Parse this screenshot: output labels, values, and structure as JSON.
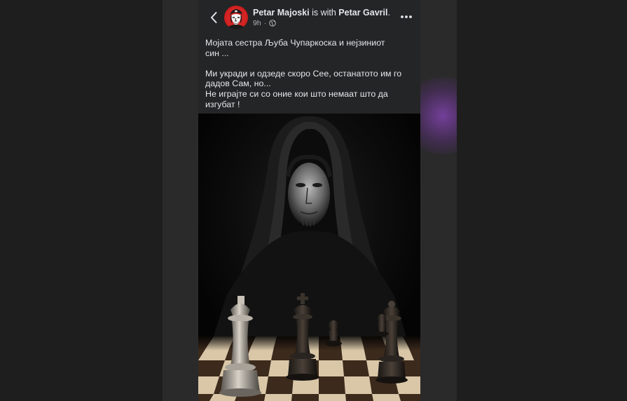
{
  "post": {
    "author": "Petar Majoski",
    "with_text": "is with",
    "tagged": "Petar Gavril",
    "period": ".",
    "time": "9h",
    "separator": "·",
    "privacy_icon": "globe-icon",
    "text_lines": [
      "Мојата сестра Љуба Чупаркоска и нејзиниот",
      "син ...",
      "",
      "Ми укради и одзеде скоро Сее, останатото им го",
      "дадов Сам, но...",
      "Не играјте си со оние кои што немаат што да",
      "изгубат !"
    ],
    "image_subject": "hooded-figure-chess-image"
  },
  "header": {
    "back_icon": "chevron-left-icon",
    "more_icon": "more-dots-icon"
  },
  "colors": {
    "panel": "#242526",
    "backdrop": "#2a2a2b",
    "outer": "#1e1e1e",
    "text": "#e4e6eb",
    "secondary_text": "#b0b3b8",
    "avatar_red": "#c81e1e",
    "glow": "#8c46be"
  }
}
